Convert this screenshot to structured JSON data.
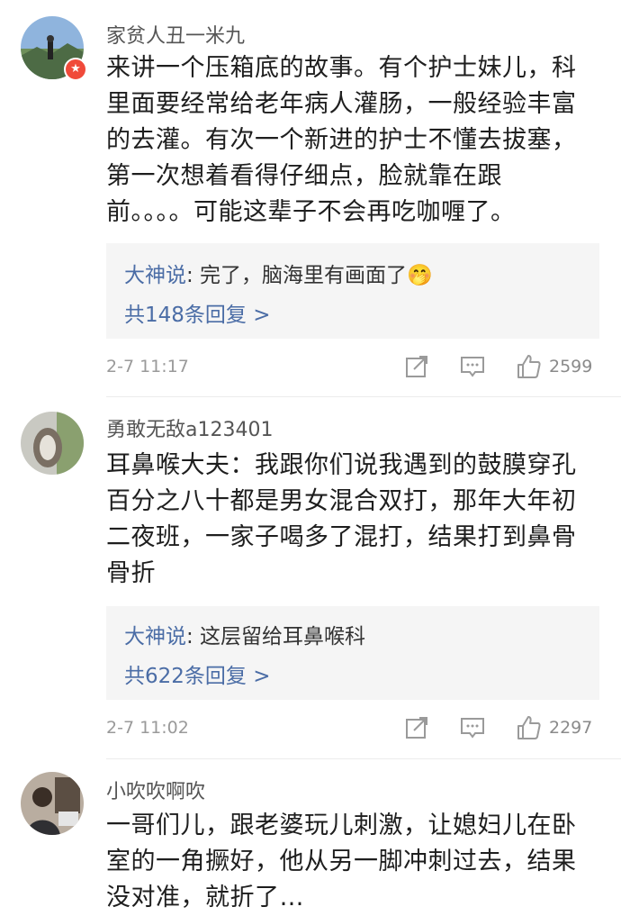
{
  "comments": [
    {
      "username": "家贫人丑一米九",
      "lines": [
        "来讲一个压箱底的故事。有个护士妹儿，科",
        "里面要经常给老年病人灌肠，一般经验丰富",
        "的去灌。有次一个新进的护士不懂去拔塞，",
        "第一次想着看得仔细点，脸就靠在跟",
        "前。。。。可能这辈子不会再吃咖喱了。"
      ],
      "reply_author": "大神说",
      "reply_text": ": 完了，脑海里有画面了",
      "reply_emoji": "🤭",
      "reply_count": "共148条回复 >",
      "timestamp": "2-7 11:17",
      "likes": "2599"
    },
    {
      "username": "勇敢无敌a123401",
      "lines": [
        "耳鼻喉大夫：我跟你们说我遇到的鼓膜穿孔",
        "百分之八十都是男女混合双打，那年大年初",
        "二夜班，一家子喝多了混打，结果打到鼻骨",
        "骨折"
      ],
      "reply_author": "大神说",
      "reply_text": ": 这层留给耳鼻喉科",
      "reply_count": "共622条回复 >",
      "timestamp": "2-7 11:02",
      "likes": "2297"
    },
    {
      "username": "小吹吹啊吹",
      "lines": [
        "一哥们儿，跟老婆玩儿刺激，让媳妇儿在卧",
        "室的一角撅好，他从另一脚冲刺过去，结果",
        "没对准，就折了…"
      ]
    }
  ]
}
